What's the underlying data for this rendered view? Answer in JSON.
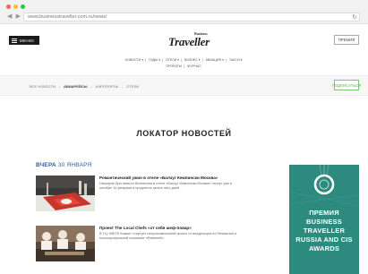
{
  "browser": {
    "url": "www.businesstraveller.com.ru/news/",
    "nav_arrows": "◀ ▶",
    "reload_icon": "↻"
  },
  "header": {
    "menu_label": "МЕНЮ",
    "logo_small": "Business",
    "logo_main": "Traveller",
    "prize_label": "ПРЕМИЯ"
  },
  "topnav": {
    "row1": [
      "НОВОСТИ ▾",
      "ГИДЫ ▾",
      "ОТЕЛИ ▾",
      "БИЗНЕС ▾",
      "АВИАЦИЯ ▾",
      "ТАКСИ ▾"
    ],
    "row2": [
      "ПРОЕКТЫ",
      "ЖУРНАЛ"
    ]
  },
  "section_nav": {
    "items": [
      "ВСЕ НОВОСТИ",
      "АВИАРЕЙСЫ",
      "АЭРОПОРТЫ",
      "ОТЕЛИ"
    ],
    "active_index": 1,
    "subscribe_label": "ПОДПИСАТЬСЯ"
  },
  "main": {
    "title": "ЛОКАТОР НОВОСТЕЙ",
    "date_day": "ВЧЕРА",
    "date_rest": "30 ЯНВАРЯ",
    "news": [
      {
        "title": "Романтический ужин в отеле «Балчуг Кемпински Москва»",
        "desc": "Накануне Дня святого Валентина в отеле «Балчуг Кемпински Москва» начнут уже в октябре 14 февраля и продлятся целых пять дней."
      },
      {
        "title": "Проект The Local Chefs «от себя шеф-повар»",
        "desc": "В ТЦ «МЕГА Химки» стартует гастрономический проект от владельцев по Restaurant и многопрофильной компании «Фемелей»."
      }
    ]
  },
  "ad": {
    "lines": [
      "ПРЕМИЯ",
      "BUSINESS",
      "TRAVELLER",
      "RUSSIA AND CIS",
      "AWARDS"
    ],
    "bg_color": "#2c8a7e"
  }
}
